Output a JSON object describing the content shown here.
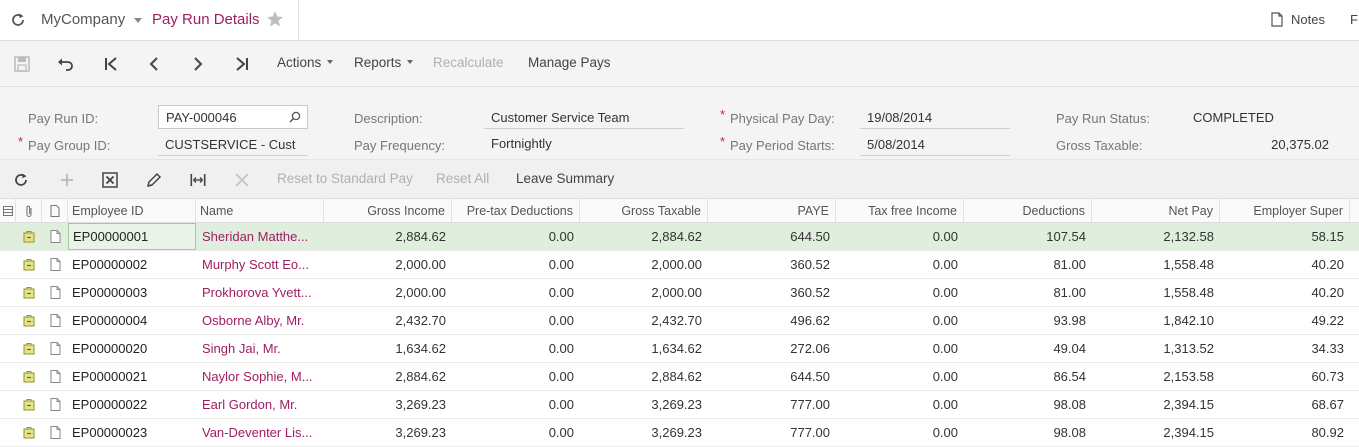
{
  "titlebar": {
    "company": "MyCompany",
    "page_title": "Pay Run Details",
    "notes_label": "Notes",
    "cut_label": "F"
  },
  "toolbar": {
    "actions_label": "Actions",
    "reports_label": "Reports",
    "recalculate_label": "Recalculate",
    "manage_pays_label": "Manage Pays"
  },
  "form": {
    "pay_run_id_label": "Pay Run ID:",
    "pay_run_id_value": "PAY-000046",
    "pay_group_id_label": "Pay Group ID:",
    "pay_group_id_value": "CUSTSERVICE - Cust",
    "description_label": "Description:",
    "description_value": "Customer Service Team",
    "pay_frequency_label": "Pay Frequency:",
    "pay_frequency_value": "Fortnightly",
    "physical_pay_day_label": "Physical Pay Day:",
    "physical_pay_day_value": "19/08/2014",
    "pay_period_starts_label": "Pay Period Starts:",
    "pay_period_starts_value": "5/08/2014",
    "pay_run_status_label": "Pay Run Status:",
    "pay_run_status_value": "COMPLETED",
    "gross_taxable_label": "Gross Taxable:",
    "gross_taxable_value": "20,375.02",
    "required_mark": "*"
  },
  "grid_toolbar": {
    "reset_standard_label": "Reset to Standard Pay",
    "reset_all_label": "Reset All",
    "leave_summary_label": "Leave Summary"
  },
  "grid": {
    "columns": [
      "Employee ID",
      "Name",
      "Gross Income",
      "Pre-tax Deductions",
      "Gross Taxable",
      "PAYE",
      "Tax free Income",
      "Deductions",
      "Net Pay",
      "Employer Super"
    ],
    "rows": [
      {
        "id": "EP00000001",
        "name": "Sheridan Matthe...",
        "gross_income": "2,884.62",
        "pretax": "0.00",
        "gross_taxable": "2,884.62",
        "paye": "644.50",
        "tax_free": "0.00",
        "deductions": "107.54",
        "net_pay": "2,132.58",
        "super": "58.15"
      },
      {
        "id": "EP00000002",
        "name": "Murphy Scott Eo...",
        "gross_income": "2,000.00",
        "pretax": "0.00",
        "gross_taxable": "2,000.00",
        "paye": "360.52",
        "tax_free": "0.00",
        "deductions": "81.00",
        "net_pay": "1,558.48",
        "super": "40.20"
      },
      {
        "id": "EP00000003",
        "name": "Prokhorova Yvett...",
        "gross_income": "2,000.00",
        "pretax": "0.00",
        "gross_taxable": "2,000.00",
        "paye": "360.52",
        "tax_free": "0.00",
        "deductions": "81.00",
        "net_pay": "1,558.48",
        "super": "40.20"
      },
      {
        "id": "EP00000004",
        "name": "Osborne Alby, Mr.",
        "gross_income": "2,432.70",
        "pretax": "0.00",
        "gross_taxable": "2,432.70",
        "paye": "496.62",
        "tax_free": "0.00",
        "deductions": "93.98",
        "net_pay": "1,842.10",
        "super": "49.22"
      },
      {
        "id": "EP00000020",
        "name": "Singh Jai, Mr.",
        "gross_income": "1,634.62",
        "pretax": "0.00",
        "gross_taxable": "1,634.62",
        "paye": "272.06",
        "tax_free": "0.00",
        "deductions": "49.04",
        "net_pay": "1,313.52",
        "super": "34.33"
      },
      {
        "id": "EP00000021",
        "name": "Naylor Sophie, M...",
        "gross_income": "2,884.62",
        "pretax": "0.00",
        "gross_taxable": "2,884.62",
        "paye": "644.50",
        "tax_free": "0.00",
        "deductions": "86.54",
        "net_pay": "2,153.58",
        "super": "60.73"
      },
      {
        "id": "EP00000022",
        "name": "Earl Gordon, Mr.",
        "gross_income": "3,269.23",
        "pretax": "0.00",
        "gross_taxable": "3,269.23",
        "paye": "777.00",
        "tax_free": "0.00",
        "deductions": "98.08",
        "net_pay": "2,394.15",
        "super": "68.67"
      },
      {
        "id": "EP00000023",
        "name": "Van-Deventer Lis...",
        "gross_income": "3,269.23",
        "pretax": "0.00",
        "gross_taxable": "3,269.23",
        "paye": "777.00",
        "tax_free": "0.00",
        "deductions": "98.08",
        "net_pay": "2,394.15",
        "super": "80.92"
      }
    ]
  },
  "icons": {
    "refresh": "refresh-icon",
    "star": "star-icon",
    "notes": "notes-icon",
    "save": "save-icon",
    "undo": "undo-icon",
    "first": "first-icon",
    "prev": "prev-icon",
    "next": "next-icon",
    "last": "last-icon"
  },
  "colors": {
    "accent": "#9e1e62",
    "selected_row": "#dfeedd",
    "required": "#c62828"
  }
}
